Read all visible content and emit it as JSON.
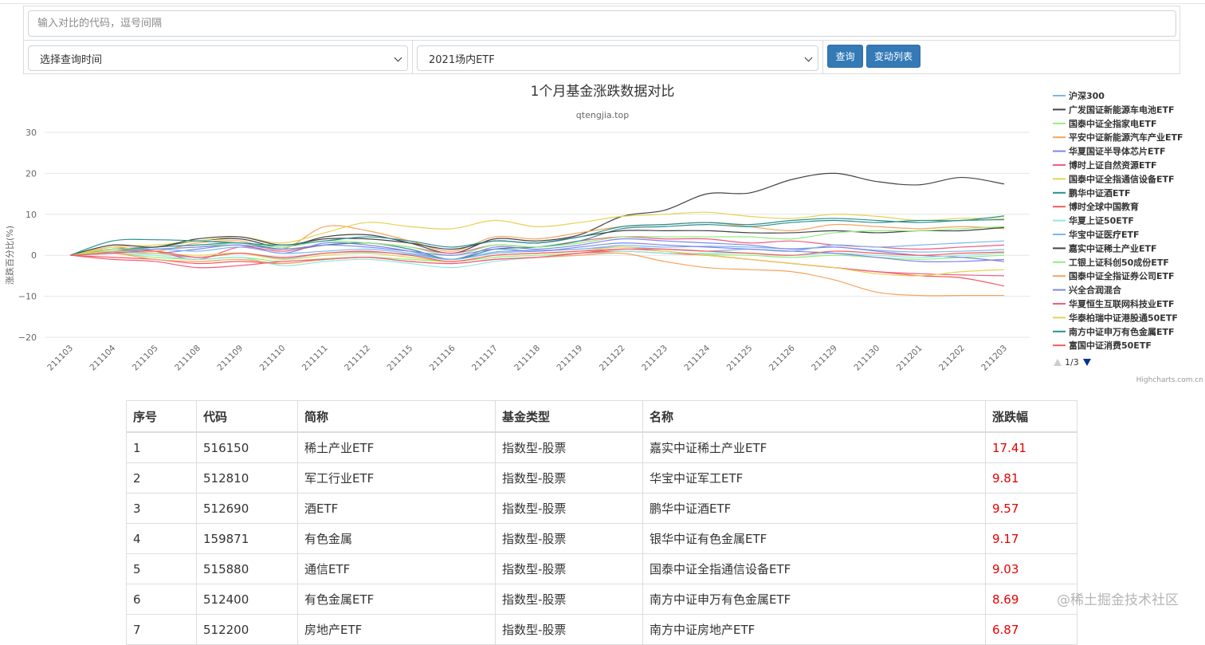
{
  "form": {
    "codes_placeholder": "输入对比的代码，逗号间隔",
    "time_select": "选择查询时间",
    "list_select": "2021场内ETF",
    "query_button": "查询",
    "changes_button": "变动列表"
  },
  "chart_data": {
    "type": "line",
    "title": "1个月基金涨跌数据对比",
    "subtitle": "qtengjia.top",
    "ylabel": "涨跌百分比(%)",
    "ylim": [
      -20,
      30
    ],
    "yticks": [
      "30",
      "20",
      "10",
      "0",
      "−10",
      "−20"
    ],
    "grid": true,
    "legend_position": "right",
    "legend_pager": "1/3",
    "credits": "Highcharts.com.cn",
    "categories": [
      "211103",
      "211104",
      "211105",
      "211108",
      "211109",
      "211110",
      "211111",
      "211112",
      "211115",
      "211116",
      "211117",
      "211118",
      "211119",
      "211122",
      "211123",
      "211124",
      "211125",
      "211126",
      "211129",
      "211130",
      "211201",
      "211202",
      "211203"
    ],
    "series": [
      {
        "name": "沪深300",
        "color": "#7cb5ec",
        "values": [
          0,
          0.8,
          0.5,
          -0.5,
          0.5,
          -0.8,
          0.5,
          0.8,
          0.2,
          -1.0,
          0.8,
          1.2,
          1.5,
          2.4,
          2.0,
          2.2,
          2.0,
          1.6,
          2.0,
          1.2,
          0.8,
          1.0,
          1.4
        ]
      },
      {
        "name": "广发国证新能源车电池ETF",
        "color": "#434348",
        "values": [
          0,
          1.5,
          2.0,
          3.5,
          4.0,
          2.0,
          4.5,
          5.0,
          3.0,
          0.5,
          4.0,
          3.5,
          5.0,
          9.5,
          11.0,
          15.0,
          15.2,
          18.5,
          20.0,
          18.0,
          17.2,
          19.0,
          17.4
        ]
      },
      {
        "name": "国泰中证全指家电ETF",
        "color": "#90ed7d",
        "values": [
          0,
          0.5,
          -0.5,
          -1.0,
          -0.5,
          -1.5,
          -0.8,
          -0.5,
          -1.0,
          -1.5,
          -0.5,
          0.0,
          0.5,
          1.0,
          0.5,
          0.2,
          0.0,
          -0.5,
          0.0,
          -0.5,
          -1.0,
          -0.5,
          0.0
        ]
      },
      {
        "name": "平安中证新能源汽车产业ETF",
        "color": "#f7a35c",
        "values": [
          0,
          2.0,
          1.0,
          3.0,
          3.5,
          1.5,
          7.0,
          6.0,
          3.5,
          1.0,
          4.5,
          4.0,
          5.5,
          7.0,
          7.5,
          8.0,
          7.0,
          6.0,
          7.5,
          7.0,
          6.5,
          7.0,
          6.5
        ]
      },
      {
        "name": "华夏国证半导体芯片ETF",
        "color": "#8085e9",
        "values": [
          0,
          1.0,
          0.5,
          1.5,
          2.5,
          0.5,
          3.0,
          2.5,
          1.0,
          -1.0,
          2.0,
          1.5,
          2.5,
          4.0,
          3.5,
          3.0,
          2.5,
          1.5,
          2.0,
          1.0,
          0.0,
          -0.5,
          -1.5
        ]
      },
      {
        "name": "博时上证自然资源ETF",
        "color": "#f15c80",
        "values": [
          0,
          1.5,
          1.0,
          -1.0,
          2.0,
          1.0,
          2.5,
          3.0,
          2.0,
          0.5,
          2.5,
          2.0,
          3.5,
          4.5,
          4.0,
          4.0,
          3.0,
          3.5,
          2.5,
          2.0,
          1.5,
          2.0,
          2.5
        ]
      },
      {
        "name": "国泰中证全指通信设备ETF",
        "color": "#e4d354",
        "values": [
          0,
          2.0,
          2.5,
          3.5,
          4.5,
          3.0,
          5.5,
          8.0,
          7.0,
          6.5,
          8.5,
          7.0,
          8.0,
          9.5,
          10.0,
          10.5,
          9.5,
          9.0,
          10.0,
          9.5,
          8.5,
          9.0,
          9.0
        ]
      },
      {
        "name": "鹏华中证酒ETF",
        "color": "#2b908f",
        "values": [
          0,
          1.0,
          2.0,
          2.5,
          3.0,
          1.5,
          2.5,
          3.0,
          1.5,
          -1.0,
          1.5,
          2.0,
          3.5,
          6.5,
          7.0,
          7.5,
          7.0,
          8.0,
          8.5,
          8.0,
          8.5,
          8.5,
          9.6
        ]
      },
      {
        "name": "博时全球中国教育",
        "color": "#f45b5b",
        "values": [
          0,
          -0.5,
          -1.0,
          -2.0,
          -1.5,
          -2.0,
          -1.0,
          -0.5,
          -1.5,
          -2.0,
          -1.0,
          -0.5,
          0.5,
          1.0,
          0.5,
          0.0,
          -1.0,
          -2.0,
          -3.0,
          -4.0,
          -5.0,
          -5.5,
          -7.5
        ]
      },
      {
        "name": "华夏上证50ETF",
        "color": "#91e8e1",
        "values": [
          0,
          0.5,
          0.0,
          -1.0,
          -0.5,
          -2.5,
          -1.5,
          -1.0,
          -2.0,
          -3.0,
          -1.5,
          -0.5,
          0.0,
          1.0,
          0.5,
          0.5,
          0.5,
          0.0,
          0.5,
          0.0,
          -0.5,
          0.0,
          0.5
        ]
      },
      {
        "name": "华宝中证医疗ETF",
        "color": "#7cb5ec",
        "values": [
          0,
          0.5,
          1.5,
          1.0,
          2.0,
          0.5,
          1.0,
          1.5,
          0.5,
          -1.0,
          0.5,
          1.0,
          1.5,
          2.0,
          1.5,
          1.0,
          1.5,
          1.0,
          2.5,
          2.0,
          2.5,
          3.0,
          3.5
        ]
      },
      {
        "name": "嘉实中证稀土产业ETF",
        "color": "#434348",
        "values": [
          0,
          2.5,
          2.0,
          4.0,
          4.5,
          2.5,
          4.0,
          4.0,
          3.0,
          1.5,
          3.5,
          3.0,
          4.5,
          6.0,
          6.0,
          6.0,
          5.5,
          5.5,
          6.0,
          5.5,
          6.0,
          6.0,
          6.8
        ]
      },
      {
        "name": "工银上证科创50成份ETF",
        "color": "#90ed7d",
        "values": [
          0,
          1.5,
          1.5,
          2.0,
          3.0,
          2.0,
          3.5,
          3.0,
          2.0,
          0.0,
          2.5,
          2.0,
          3.0,
          4.5,
          4.5,
          4.5,
          4.5,
          4.0,
          5.5,
          6.0,
          6.0,
          6.5,
          7.0
        ]
      },
      {
        "name": "国泰中证全指证券公司ETF",
        "color": "#f7a35c",
        "values": [
          0,
          0.5,
          -1.0,
          -1.5,
          -1.0,
          -2.0,
          -1.0,
          -0.5,
          -1.5,
          -2.0,
          -1.0,
          -0.5,
          0.0,
          0.5,
          -1.5,
          -3.0,
          -3.5,
          -4.0,
          -6.0,
          -9.0,
          -9.8,
          -9.8,
          -9.8
        ]
      },
      {
        "name": "兴全合润混合",
        "color": "#8085e9",
        "values": [
          0,
          1.0,
          1.5,
          2.0,
          2.5,
          1.5,
          2.5,
          2.0,
          1.0,
          0.0,
          1.5,
          1.0,
          2.0,
          3.0,
          2.5,
          2.0,
          1.5,
          1.0,
          0.5,
          -0.5,
          -1.5,
          -1.5,
          -1.0
        ]
      },
      {
        "name": "华夏恒生互联网科技业ETF",
        "color": "#f15c80",
        "values": [
          0,
          -1.0,
          -1.5,
          -3.0,
          -2.5,
          -1.5,
          -1.0,
          -0.5,
          -1.5,
          -2.0,
          -1.0,
          -0.5,
          0.5,
          1.5,
          1.0,
          0.0,
          -1.0,
          -2.0,
          -3.0,
          -4.0,
          -4.5,
          -4.8,
          -5.0
        ]
      },
      {
        "name": "华泰柏瑞中证港股通50ETF",
        "color": "#e4d354",
        "values": [
          0,
          1.0,
          0.5,
          0.0,
          0.5,
          -1.0,
          0.0,
          0.5,
          -0.5,
          -1.5,
          0.0,
          0.5,
          1.0,
          2.0,
          1.0,
          0.0,
          -1.0,
          -2.0,
          -3.0,
          -4.5,
          -5.0,
          -4.0,
          -3.5
        ]
      },
      {
        "name": "南方中证申万有色金属ETF",
        "color": "#2b908f",
        "values": [
          0,
          3.5,
          3.8,
          3.5,
          3.0,
          2.5,
          3.5,
          4.5,
          3.5,
          2.0,
          3.5,
          3.0,
          4.5,
          7.0,
          7.5,
          8.0,
          7.5,
          8.5,
          9.0,
          8.5,
          8.0,
          8.5,
          8.7
        ]
      },
      {
        "name": "富国中证消费50ETF",
        "color": "#f45b5b",
        "values": [
          0,
          0.5,
          1.0,
          -0.5,
          0.5,
          -0.5,
          0.5,
          1.0,
          0.0,
          -1.5,
          0.0,
          0.5,
          1.0,
          1.5,
          1.5,
          1.0,
          0.5,
          0.0,
          1.0,
          0.5,
          0.0,
          0.5,
          0.8
        ]
      }
    ]
  },
  "table": {
    "headers": [
      "序号",
      "代码",
      "简称",
      "基金类型",
      "名称",
      "涨跌幅"
    ],
    "rows": [
      [
        "1",
        "516150",
        "稀土产业ETF",
        "指数型-股票",
        "嘉实中证稀土产业ETF",
        "17.41"
      ],
      [
        "2",
        "512810",
        "军工行业ETF",
        "指数型-股票",
        "华宝中证军工ETF",
        "9.81"
      ],
      [
        "3",
        "512690",
        "酒ETF",
        "指数型-股票",
        "鹏华中证酒ETF",
        "9.57"
      ],
      [
        "4",
        "159871",
        "有色金属",
        "指数型-股票",
        "银华中证有色金属ETF",
        "9.17"
      ],
      [
        "5",
        "515880",
        "通信ETF",
        "指数型-股票",
        "国泰中证全指通信设备ETF",
        "9.03"
      ],
      [
        "6",
        "512400",
        "有色金属ETF",
        "指数型-股票",
        "南方中证申万有色金属ETF",
        "8.69"
      ],
      [
        "7",
        "512200",
        "房地产ETF",
        "指数型-股票",
        "南方中证房地产ETF",
        "6.87"
      ]
    ]
  },
  "watermark": "@稀土掘金技术社区"
}
